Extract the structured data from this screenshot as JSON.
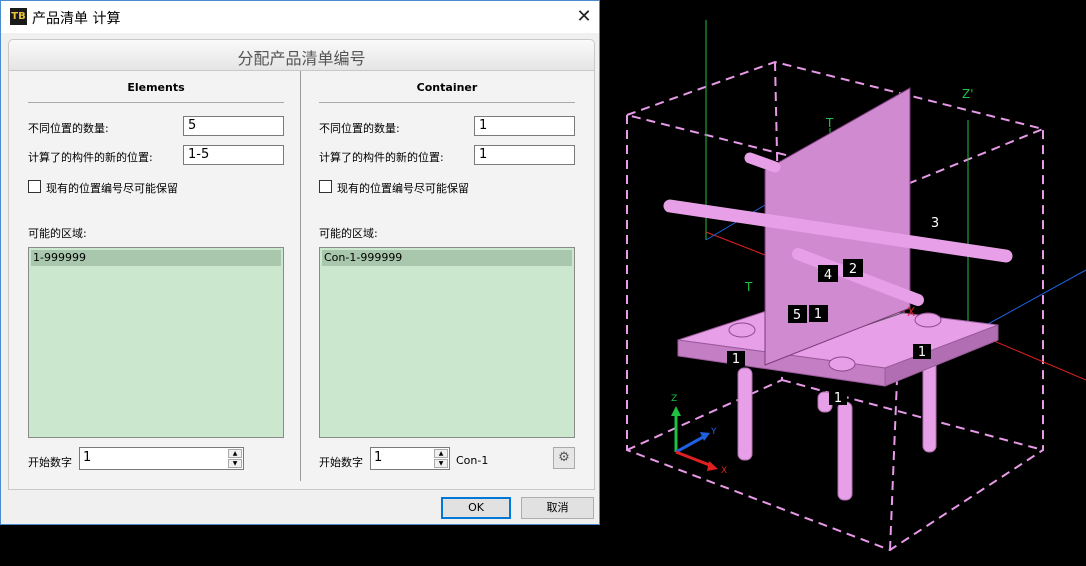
{
  "window": {
    "title": "产品清单 计算",
    "icon_text": "TB",
    "close_glyph": "✕"
  },
  "dialog": {
    "heading": "分配产品清单编号",
    "elements": {
      "title": "Elements",
      "positions_count_label": "不同位置的数量:",
      "positions_count_value": "5",
      "new_positions_label": "计算了的构件的新的位置:",
      "new_positions_value": "1-5",
      "keep_numbers_label": "现有的位置编号尽可能保留",
      "keep_numbers_checked": false,
      "range_label": "可能的区域:",
      "ranges": [
        "1-999999"
      ],
      "start_label": "开始数字",
      "start_value": "1"
    },
    "container": {
      "title": "Container",
      "positions_count_label": "不同位置的数量:",
      "positions_count_value": "1",
      "new_positions_label": "计算了的构件的新的位置:",
      "new_positions_value": "1",
      "keep_numbers_label": "现有的位置编号尽可能保留",
      "keep_numbers_checked": false,
      "range_label": "可能的区域:",
      "ranges": [
        "Con-1-999999"
      ],
      "start_label": "开始数字",
      "start_value": "1",
      "prefix": "Con-1"
    },
    "buttons": {
      "ok": "OK",
      "cancel": "取消"
    }
  },
  "viewport3d": {
    "position_tags": [
      "1",
      "2",
      "3",
      "4",
      "5",
      "1",
      "1",
      "1",
      "1"
    ],
    "axis_labels": {
      "z_prime": "Z'",
      "t_top": "T",
      "t_left": "T",
      "x_red": "X",
      "triad_z": "Z",
      "triad_y": "Y",
      "triad_x": "X"
    },
    "colors": {
      "part": "#e7a0e7",
      "plate_face": "#cf88cf",
      "bounding_box": "#e89ae8",
      "axis_green": "#20c040",
      "axis_red": "#e02020",
      "axis_blue": "#2060e0",
      "background": "#000000"
    }
  }
}
